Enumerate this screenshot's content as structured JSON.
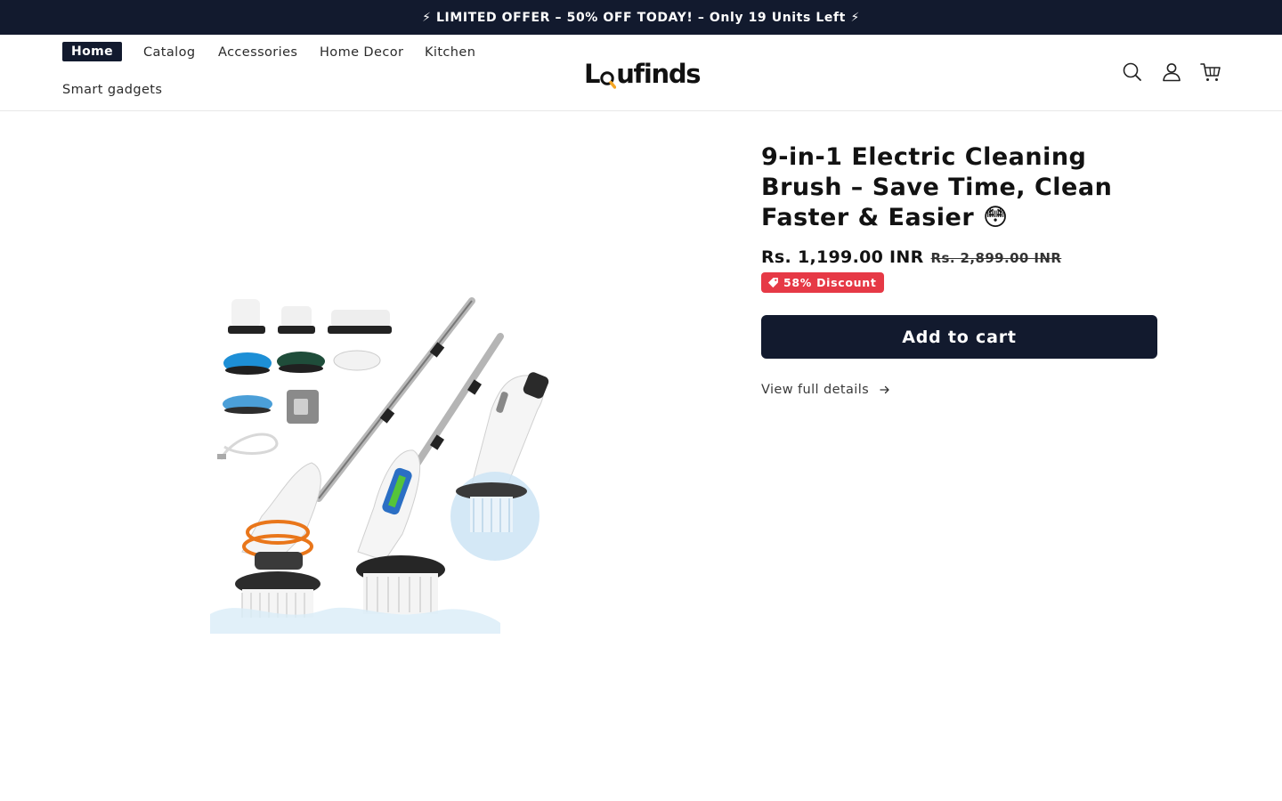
{
  "announcement": {
    "text": "⚡ LIMITED OFFER – 50% OFF TODAY! – Only 19 Units Left ⚡"
  },
  "nav": {
    "items": [
      {
        "label": "Home",
        "active": true
      },
      {
        "label": "Catalog",
        "active": false
      },
      {
        "label": "Accessories",
        "active": false
      },
      {
        "label": "Home Decor",
        "active": false
      },
      {
        "label": "Kitchen",
        "active": false
      },
      {
        "label": "Smart gadgets",
        "active": false
      }
    ]
  },
  "logo": {
    "text_before": "L",
    "text_after": "ufinds",
    "accent_color": "#f5a623"
  },
  "header_icons": [
    "search-icon",
    "account-icon",
    "cart-icon"
  ],
  "product": {
    "title": "9-in-1 Electric Cleaning Brush – Save Time, Clean Faster & Easier 😳",
    "price_sale": "Rs. 1,199.00 INR",
    "price_regular": "Rs. 2,899.00 INR",
    "discount_badge": "58% Discount",
    "add_to_cart_label": "Add to cart",
    "view_details_label": "View full details"
  },
  "colors": {
    "primary_dark": "#121a2e",
    "badge_red": "#e63946",
    "text": "#121212"
  }
}
